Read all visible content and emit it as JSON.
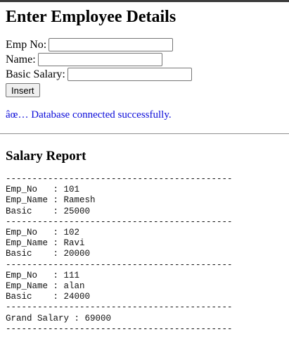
{
  "heading": "Enter Employee Details",
  "form": {
    "emp_no_label": "Emp No:",
    "emp_no_value": "",
    "name_label": "Name:",
    "name_value": "",
    "salary_label": "Basic Salary:",
    "salary_value": "",
    "insert_label": "Insert"
  },
  "status": {
    "message": "âœ… Database connected successfully.",
    "color": "#0b0bd9"
  },
  "report": {
    "title": "Salary Report",
    "separator": "-------------------------------------------",
    "employees": [
      {
        "emp_no_line": "Emp_No   : 101",
        "name_line": "Emp_Name : Ramesh",
        "basic_line": "Basic    : 25000"
      },
      {
        "emp_no_line": "Emp_No   : 102",
        "name_line": "Emp_Name : Ravi",
        "basic_line": "Basic    : 20000"
      },
      {
        "emp_no_line": "Emp_No   : 111",
        "name_line": "Emp_Name : alan",
        "basic_line": "Basic    : 24000"
      }
    ],
    "grand_total_line": "Grand Salary : 69000"
  }
}
